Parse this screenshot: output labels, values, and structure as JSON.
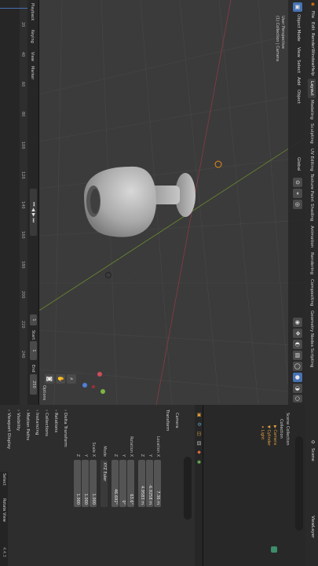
{
  "menu": [
    "File",
    "Edit",
    "Render",
    "Window",
    "Help"
  ],
  "workspace_tabs": [
    "Layout",
    "Modeling",
    "Sculpting",
    "UV Editing",
    "Texture Paint",
    "Shading",
    "Animation",
    "Rendering",
    "Compositing",
    "Geometry Nodes",
    "Scripting"
  ],
  "active_tab": "Layout",
  "scene_label": "Scene",
  "viewlayer_label": "ViewLayer",
  "viewport": {
    "mode": "Object Mode",
    "menus": [
      "View",
      "Select",
      "Add",
      "Object"
    ],
    "transform_orientation": "Global",
    "overlay_title": "User Perspective",
    "overlay_sub": "(1) Collection | Camera",
    "options_label": "Options"
  },
  "timeline": {
    "menus": [
      "Playback",
      "Keying",
      "View",
      "Marker"
    ],
    "ticks": [
      "20",
      "40",
      "60",
      "80",
      "100",
      "120",
      "140",
      "160",
      "180",
      "200",
      "220",
      "240"
    ],
    "current_frame": "1",
    "start_label": "Start",
    "start_value": "1",
    "end_label": "End",
    "end_value": "250"
  },
  "outliner": {
    "title": "Scene Collection",
    "items": [
      "Collection",
      "Camera",
      "Cylinder",
      "Light"
    ]
  },
  "properties": {
    "object_name": "Camera",
    "transform_header": "Transform",
    "location_label": "Location X",
    "location": [
      "7.36 m",
      "-6.9258 m",
      "4.9583 m"
    ],
    "rotation_label": "Rotation X",
    "rotation": [
      "63.6°",
      "0°",
      "46.692°"
    ],
    "mode_label": "Mode",
    "mode_value": "XYZ Euler",
    "scale_label": "Scale X",
    "scale": [
      "1.000",
      "1.000",
      "1.000"
    ],
    "axes": [
      "Y",
      "Z"
    ],
    "collapsed": [
      "Delta Transform",
      "Relations",
      "Collections",
      "Instancing",
      "Motion Paths",
      "Visibility",
      "Viewport Display"
    ]
  },
  "status": {
    "left": "Select",
    "middle": "Rotate View",
    "version": "4.4.3"
  }
}
